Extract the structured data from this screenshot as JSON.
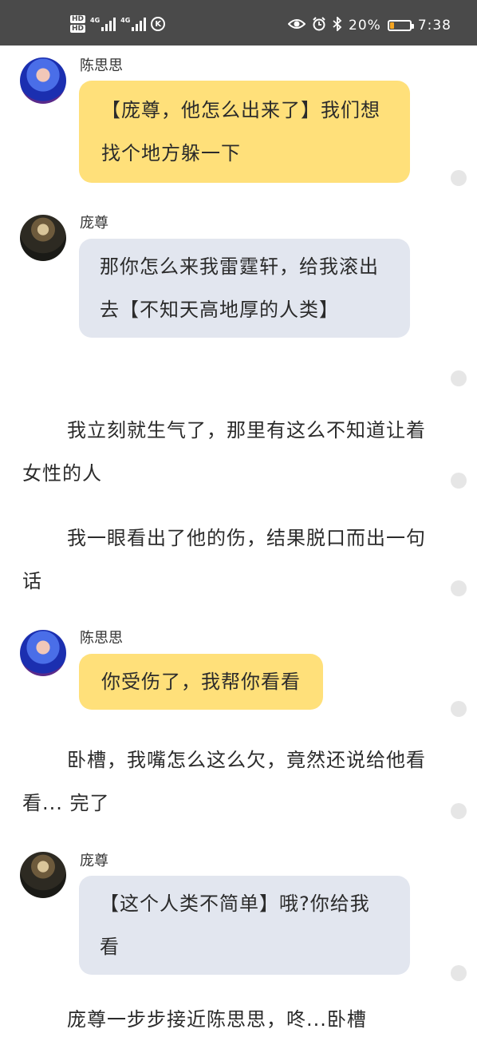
{
  "status_bar": {
    "hd1": "HD",
    "hd2": "HD",
    "net1": "4G",
    "net2": "4G",
    "k_icon": "K",
    "battery_percent": "20%",
    "battery_level": 0.2,
    "time": "7:38",
    "icons": [
      "eye-icon",
      "alarm-icon",
      "bluetooth-icon"
    ],
    "battery_color": "#f5a623"
  },
  "messages": [
    {
      "type": "chat",
      "sender": "陈思思",
      "avatar": "blue-hair-avatar",
      "bubble_color": "#ffe07a",
      "text": "【庞尊，他怎么出来了】我们想找个地方躲一下"
    },
    {
      "type": "chat",
      "sender": "庞尊",
      "avatar": "dark-warrior-avatar",
      "bubble_color": "#e2e6ef",
      "text": "那你怎么来我雷霆轩，给我滚出去【不知天高地厚的人类】"
    },
    {
      "type": "narration",
      "text": "我立刻就生气了，那里有这么不知道让着女性的人"
    },
    {
      "type": "narration",
      "text": "我一眼看出了他的伤，结果脱口而出一句话"
    },
    {
      "type": "chat",
      "sender": "陈思思",
      "avatar": "blue-hair-avatar",
      "bubble_color": "#ffe07a",
      "text": "你受伤了，我帮你看看"
    },
    {
      "type": "narration",
      "text": "卧槽，我嘴怎么这么欠，竟然还说给他看看... 完了"
    },
    {
      "type": "chat",
      "sender": "庞尊",
      "avatar": "dark-warrior-avatar",
      "bubble_color": "#e2e6ef",
      "text": "【这个人类不简单】哦?你给我看"
    },
    {
      "type": "narration",
      "text": "庞尊一步步接近陈思思，咚...卧槽"
    }
  ]
}
